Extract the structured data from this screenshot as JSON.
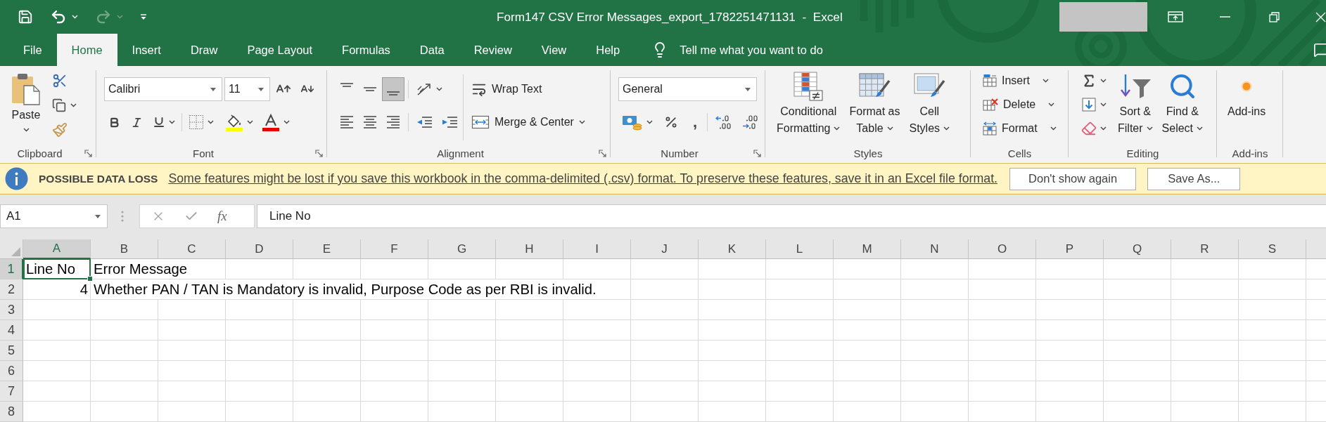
{
  "quick_access": [
    {
      "kind": "save",
      "disabled": false
    },
    {
      "kind": "undo",
      "disabled": false
    },
    {
      "kind": "redo",
      "disabled": true
    }
  ],
  "window": {
    "title": "Form147 CSV Error Messages_export_1782251471131  -  Excel"
  },
  "ribbon_tabs": [
    {
      "label": "File",
      "selected": false
    },
    {
      "label": "Home",
      "selected": true
    },
    {
      "label": "Insert",
      "selected": false
    },
    {
      "label": "Draw",
      "selected": false
    },
    {
      "label": "Page Layout",
      "selected": false
    },
    {
      "label": "Formulas",
      "selected": false
    },
    {
      "label": "Data",
      "selected": false
    },
    {
      "label": "Review",
      "selected": false
    },
    {
      "label": "View",
      "selected": false
    },
    {
      "label": "Help",
      "selected": false
    }
  ],
  "tell_me": {
    "placeholder": "Tell me what you want to do"
  },
  "ribbon_groups": [
    {
      "kind": "clipboard",
      "label": "Clipboard",
      "paste": "Paste"
    },
    {
      "kind": "font",
      "label": "Font",
      "font_name": "Calibri",
      "font_size": "11"
    },
    {
      "kind": "alignment",
      "label": "Alignment",
      "vertical_align": [
        {
          "kind": "top",
          "selected": false
        },
        {
          "kind": "middle",
          "selected": false
        },
        {
          "kind": "bottom",
          "selected": true
        }
      ],
      "wrap_text": "Wrap Text",
      "merge": "Merge & Center"
    },
    {
      "kind": "number",
      "label": "Number",
      "format": "General",
      "comma": ","
    },
    {
      "kind": "styles",
      "label": "Styles",
      "buttons": [
        {
          "kind": "conditional_formatting",
          "lines": [
            "Conditional",
            "Formatting"
          ]
        },
        {
          "kind": "format_as_table",
          "lines": [
            "Format as",
            "Table"
          ]
        },
        {
          "kind": "cell_styles",
          "lines": [
            "Cell",
            "Styles"
          ]
        }
      ]
    },
    {
      "kind": "cells",
      "label": "Cells",
      "buttons": [
        {
          "kind": "insert",
          "label": "Insert"
        },
        {
          "kind": "delete",
          "label": "Delete"
        },
        {
          "kind": "format",
          "label": "Format"
        }
      ]
    },
    {
      "kind": "editing",
      "label": "Editing",
      "buttons": [
        {
          "kind": "sort_filter",
          "lines": [
            "Sort &",
            "Filter"
          ]
        },
        {
          "kind": "find_select",
          "lines": [
            "Find &",
            "Select"
          ]
        }
      ]
    },
    {
      "kind": "addins",
      "label": "Add-ins",
      "button": "Add-ins"
    }
  ],
  "info_bar": {
    "title": "POSSIBLE DATA LOSS",
    "message": "Some features might be lost if you save this workbook in the comma-delimited (.csv) format. To preserve these features, save it in an Excel file format.",
    "buttons": [
      "Don't show again",
      "Save As..."
    ]
  },
  "formula_bar": {
    "name_box": "A1",
    "insert_function": "fx",
    "formula": "Line No"
  },
  "sheet": {
    "columns": [
      {
        "label": "A",
        "selected": true
      },
      {
        "label": "B",
        "selected": false
      },
      {
        "label": "C",
        "selected": false
      },
      {
        "label": "D",
        "selected": false
      },
      {
        "label": "E",
        "selected": false
      },
      {
        "label": "F",
        "selected": false
      },
      {
        "label": "G",
        "selected": false
      },
      {
        "label": "H",
        "selected": false
      },
      {
        "label": "I",
        "selected": false
      },
      {
        "label": "J",
        "selected": false
      },
      {
        "label": "K",
        "selected": false
      },
      {
        "label": "L",
        "selected": false
      },
      {
        "label": "M",
        "selected": false
      },
      {
        "label": "N",
        "selected": false
      },
      {
        "label": "O",
        "selected": false
      },
      {
        "label": "P",
        "selected": false
      },
      {
        "label": "Q",
        "selected": false
      },
      {
        "label": "R",
        "selected": false
      },
      {
        "label": "S",
        "selected": false
      }
    ],
    "rows": [
      {
        "label": "1",
        "selected": true,
        "cells": [
          {
            "value": "Line No",
            "kind": "text",
            "selected": true
          },
          {
            "value": "Error Message",
            "kind": "text",
            "selected": false
          }
        ]
      },
      {
        "label": "2",
        "selected": false,
        "cells": [
          {
            "value": "4",
            "kind": "number",
            "selected": false
          },
          {
            "value": "Whether PAN / TAN is Mandatory is invalid, Purpose Code as per RBI is invalid.",
            "kind": "text",
            "selected": false
          }
        ]
      },
      {
        "label": "3",
        "selected": false
      },
      {
        "label": "4",
        "selected": false
      },
      {
        "label": "5",
        "selected": false
      },
      {
        "label": "6",
        "selected": false
      },
      {
        "label": "7",
        "selected": false
      },
      {
        "label": "8",
        "selected": false
      }
    ]
  }
}
